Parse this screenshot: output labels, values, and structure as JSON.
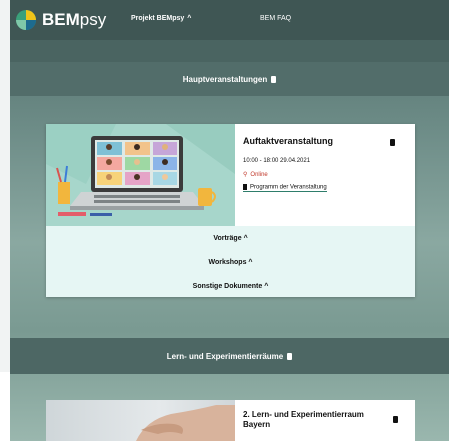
{
  "navbar": {
    "brand_bold": "BEM",
    "brand_light": "psy",
    "links": [
      "Projekt BEMpsy",
      "BEM FAQ"
    ],
    "link_chevron": "^"
  },
  "sections": [
    {
      "title": "Hauptveranstaltungen"
    },
    {
      "title": "Lern- und Experimentierräume"
    }
  ],
  "event_card": {
    "title": "Auftaktveranstaltung",
    "time": "10:00 - 18:00 29.04.2021",
    "location": "Online",
    "program_link": "Programm der Veranstaltung",
    "accordion": [
      "Vorträge",
      "Workshops",
      "Sonstige Dokumente"
    ],
    "accordion_chevron": "^"
  },
  "second_card": {
    "title": "2. Lern- und Experimentierraum Bayern"
  },
  "colors": {
    "navbar": "#3f5654",
    "section_bar": "#526d6a",
    "accordion_bg": "#e6f6f4",
    "location_red": "#c0392b",
    "logo_green": "#3aa07a"
  },
  "icons": [
    "logo-icon",
    "chevron-up-icon",
    "trash-icon",
    "map-pin-icon",
    "document-icon"
  ]
}
